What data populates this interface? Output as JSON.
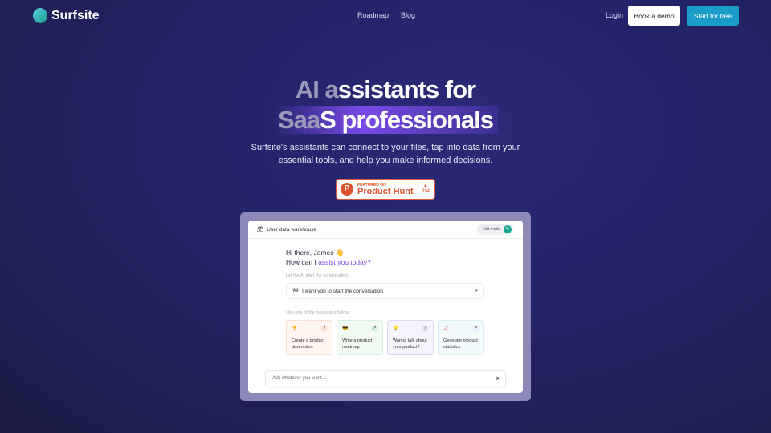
{
  "nav": {
    "brand": "Surfsite",
    "links": [
      "Roadmap",
      "Blog"
    ],
    "login": "Login",
    "demo": "Book a demo",
    "start": "Start for free"
  },
  "hero": {
    "line1_fade": "AI a",
    "line1_rest": "ssistants for",
    "line2_fade": "Saa",
    "line2_rest": "S professionals",
    "subtitle_1": "Surfsite's assistants can connect to your files, tap into data from your",
    "subtitle_2": "essential tools, and help you make informed decisions."
  },
  "producthunt": {
    "featured": "FEATURED ON",
    "name": "Product Hunt",
    "count": "894",
    "color": "#da552f"
  },
  "app": {
    "title": "User data warehouse",
    "edit_mode": "Edit mode",
    "greeting": "Hi there, James 👋",
    "question_plain": "How can I ",
    "question_accent": "assist you today?",
    "start_label": "Let the AI start the conversation:",
    "start_text": "I want you to start the conversation",
    "messages_label": "Use one of the messages below:",
    "cards": [
      {
        "icon": "🏆",
        "text": "Create a product description",
        "bg": "#fff6f1",
        "border": "#fbe0d4",
        "go": "#fde8de"
      },
      {
        "icon": "😎",
        "text": "Write a product roadmap",
        "bg": "#f1fbf4",
        "border": "#d7f1df",
        "go": "#d7f3e0"
      },
      {
        "icon": "💡",
        "text": "Wanna talk about your product?",
        "bg": "#f5f4fd",
        "border": "#dcd8f2",
        "go": "#e6e3f8"
      },
      {
        "icon": "📈",
        "text": "Generate product statistics",
        "bg": "#f2fafc",
        "border": "#d7eef2",
        "go": "#e9f0fb"
      }
    ],
    "ask_placeholder": "Ask whatever you want...."
  }
}
